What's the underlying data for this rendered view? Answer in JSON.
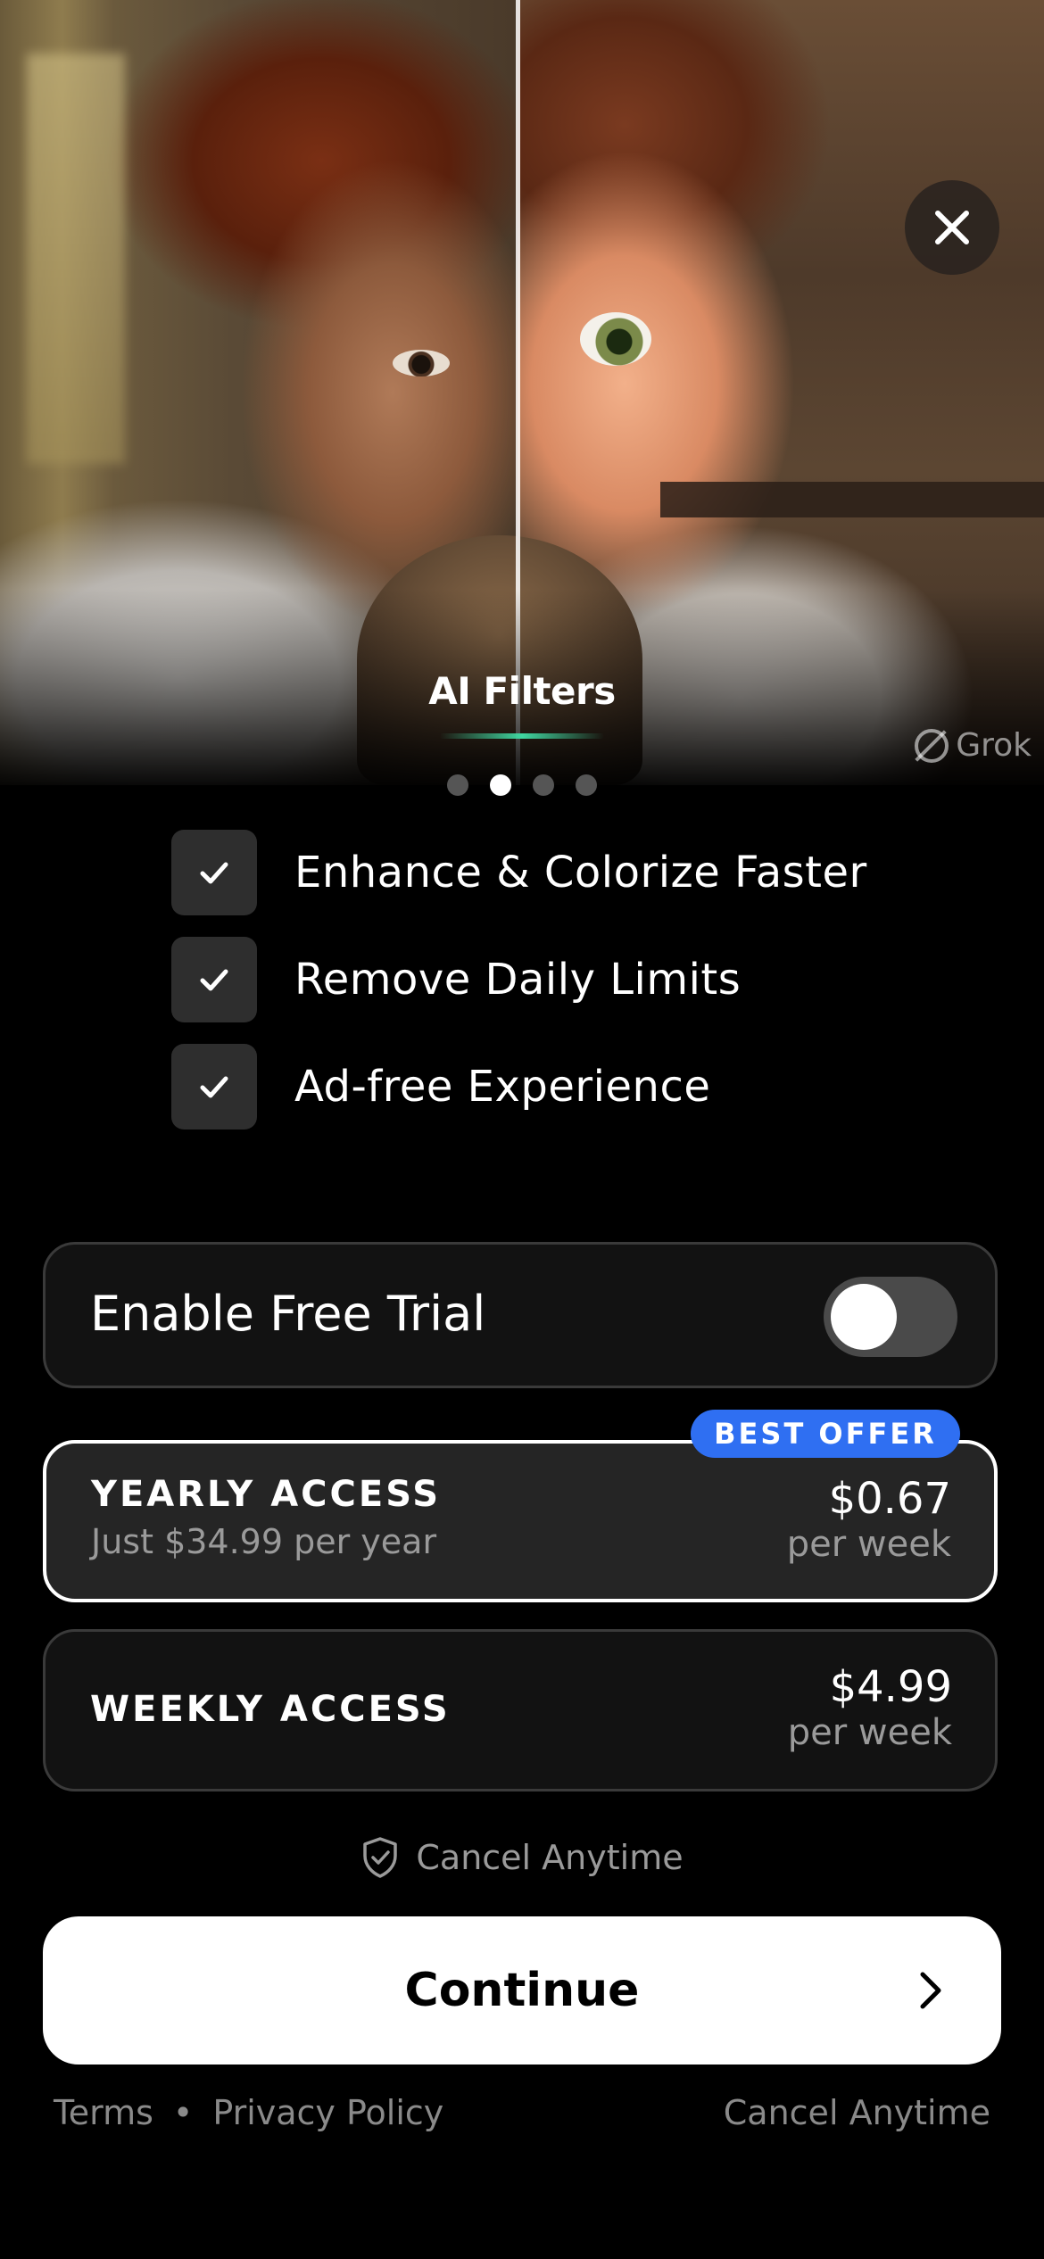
{
  "hero": {
    "filter_title": "AI Filters",
    "watermark": "Grok",
    "page_count": 4,
    "active_page": 1
  },
  "features": [
    {
      "label": "Enhance & Colorize Faster",
      "icon": "check-icon"
    },
    {
      "label": "Remove Daily Limits",
      "icon": "check-icon"
    },
    {
      "label": "Ad-free Experience",
      "icon": "check-icon"
    }
  ],
  "trial": {
    "label": "Enable Free Trial",
    "enabled": false
  },
  "plans": {
    "badge": "BEST OFFER",
    "yearly": {
      "name": "YEARLY ACCESS",
      "subtitle": "Just $34.99 per year",
      "price": "$0.67",
      "period": "per week",
      "selected": true
    },
    "weekly": {
      "name": "WEEKLY ACCESS",
      "price": "$4.99",
      "period": "per week",
      "selected": false
    }
  },
  "cancel_note": "Cancel Anytime",
  "continue_label": "Continue",
  "footer": {
    "terms": "Terms",
    "separator": "•",
    "privacy": "Privacy Policy",
    "cancel": "Cancel Anytime"
  },
  "colors": {
    "background": "#000000",
    "accent_badge": "#2f6ff2",
    "filter_underline": "#3fd6a0"
  }
}
